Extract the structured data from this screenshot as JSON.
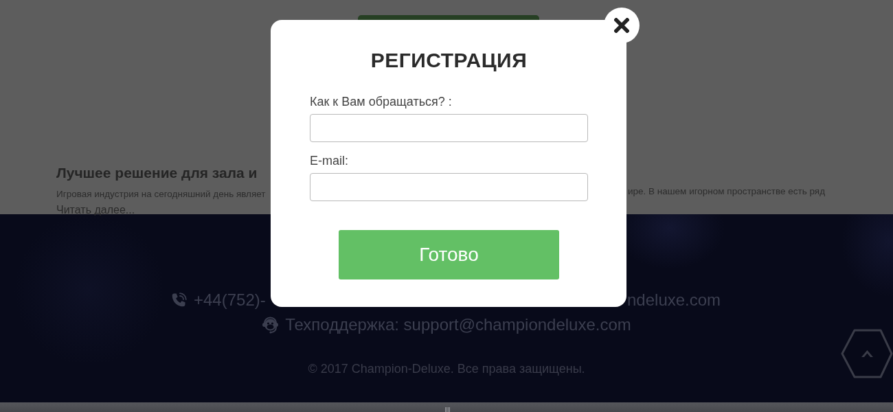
{
  "article": {
    "title": "Лучшее решение для зала и",
    "text_left": "Игровая индустрия на сегодняшний день являет",
    "text_right": "ире. В нашем игорном пространстве есть ряд",
    "read_more": "Читать далее..."
  },
  "footer": {
    "contacts": [
      {
        "kind": "phone",
        "parts": [
          "+44(752)-",
          "ndeluxe.com"
        ]
      },
      {
        "kind": "support",
        "parts": [
          "Техподдержка: support@championdeluxe.com"
        ]
      }
    ],
    "copyright": "© 2017 Champion-Deluxe. Все права защищены."
  },
  "modal": {
    "title": "РЕГИСТРАЦИЯ",
    "fields": [
      {
        "label": "Как к Вам обращаться? :"
      },
      {
        "label": "E-mail:"
      }
    ],
    "submit": "Готово"
  }
}
